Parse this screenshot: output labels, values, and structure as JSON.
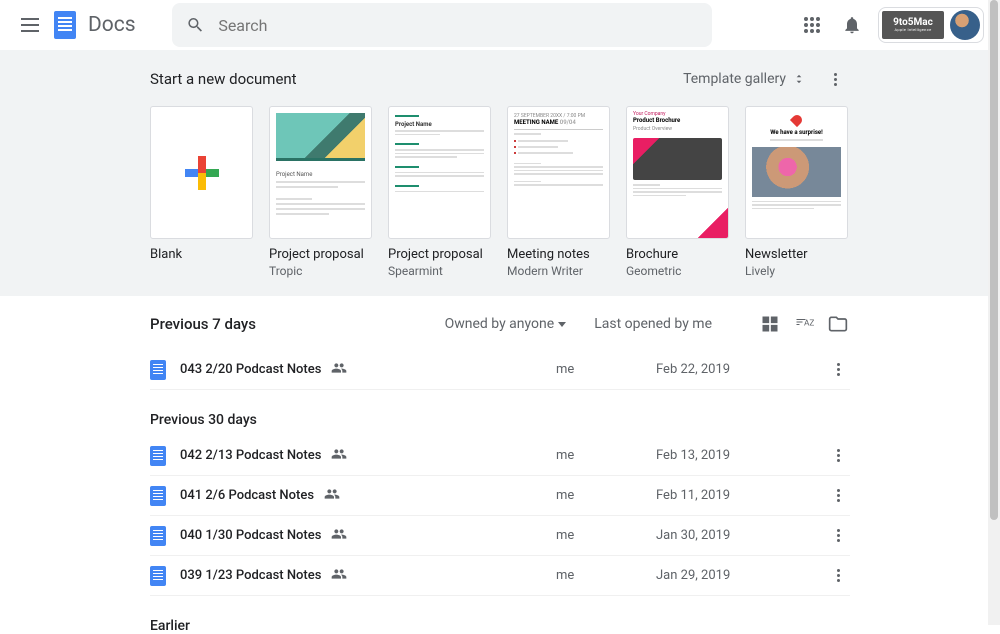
{
  "header": {
    "app_name": "Docs",
    "search_placeholder": "Search",
    "partner_brand": "9to5Mac",
    "partner_tag": "Apple Intelligence"
  },
  "templates": {
    "heading": "Start a new document",
    "gallery_label": "Template gallery",
    "items": [
      {
        "name": "Blank",
        "sub": ""
      },
      {
        "name": "Project proposal",
        "sub": "Tropic"
      },
      {
        "name": "Project proposal",
        "sub": "Spearmint"
      },
      {
        "name": "Meeting notes",
        "sub": "Modern Writer"
      },
      {
        "name": "Brochure",
        "sub": "Geometric"
      },
      {
        "name": "Newsletter",
        "sub": "Lively"
      }
    ]
  },
  "filters": {
    "owner": "Owned by anyone",
    "sort": "Last opened by me"
  },
  "groups": [
    {
      "title": "Previous 7 days",
      "rows": [
        {
          "name": "043 2/20 Podcast Notes",
          "owner": "me",
          "date": "Feb 22, 2019",
          "shared": true
        }
      ]
    },
    {
      "title": "Previous 30 days",
      "rows": [
        {
          "name": "042 2/13 Podcast Notes",
          "owner": "me",
          "date": "Feb 13, 2019",
          "shared": true
        },
        {
          "name": "041 2/6 Podcast Notes",
          "owner": "me",
          "date": "Feb 11, 2019",
          "shared": true
        },
        {
          "name": "040 1/30 Podcast Notes",
          "owner": "me",
          "date": "Jan 30, 2019",
          "shared": true
        },
        {
          "name": "039 1/23 Podcast Notes",
          "owner": "me",
          "date": "Jan 29, 2019",
          "shared": true
        }
      ]
    },
    {
      "title": "Earlier",
      "rows": []
    }
  ]
}
